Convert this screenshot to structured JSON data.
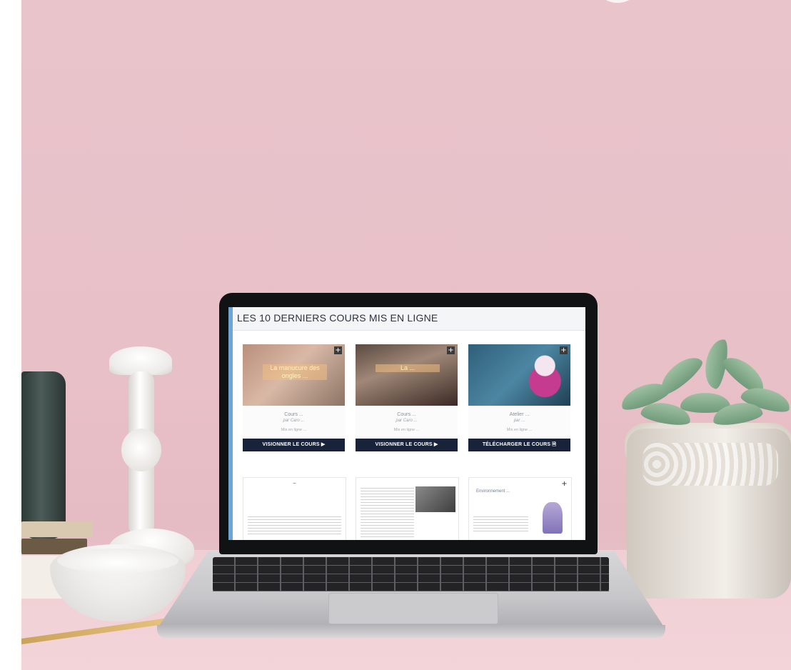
{
  "screen": {
    "title": "LES 10 DERNIERS COURS MIS EN LIGNE"
  },
  "cards": [
    {
      "overlay": "La manucure des ongles ...",
      "title": "Cours ... ",
      "author": "par Caro ...",
      "date": "Mis en ligne ...",
      "button": "VISIONNER LE COURS ▶"
    },
    {
      "overlay": "La ...",
      "title": "Cours ...",
      "author": "par Caro ...",
      "date": "Mis en ligne ...",
      "button": "VISIONNER LE COURS ▶"
    },
    {
      "overlay": "",
      "title": "Atelier ...",
      "author": "par ...",
      "date": "Mis en ligne ...",
      "button": "TÉLÉCHARGER LE COURS 🗎"
    }
  ],
  "documents": [
    {
      "heading": "..."
    },
    {
      "heading": ""
    },
    {
      "heading": "Environnement ..."
    }
  ],
  "colors": {
    "button_bg": "#182238",
    "accent": "#6fa6d8",
    "wall": "#e9c4cb"
  },
  "icons": {
    "plus": "+"
  }
}
